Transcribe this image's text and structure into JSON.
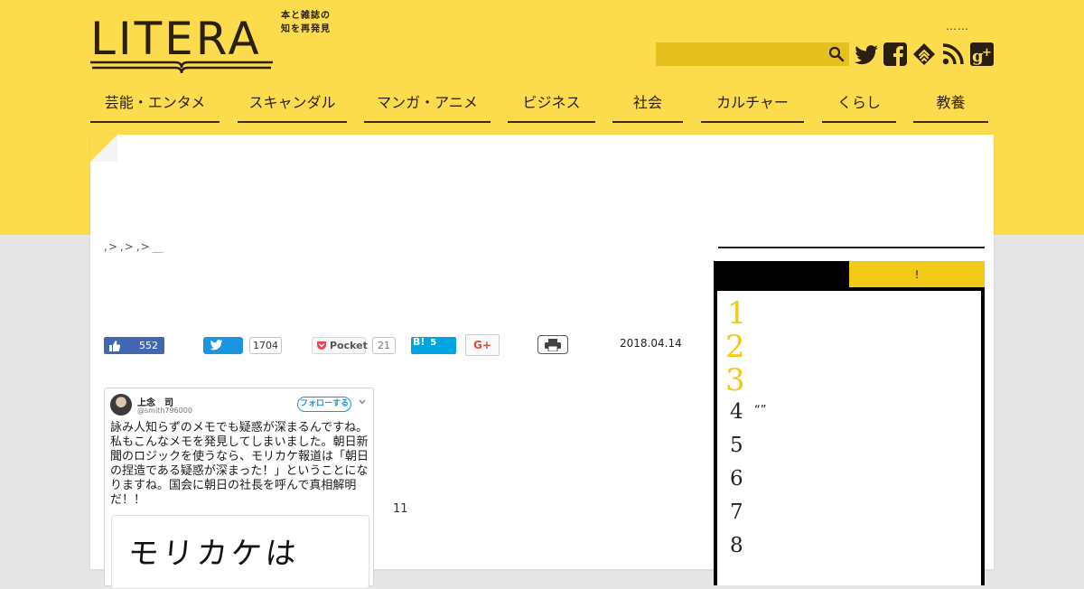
{
  "site": {
    "logo_text": "LITERA",
    "tagline_1": "本と雑誌の",
    "tagline_2": "知を再発見",
    "top_dots": "……"
  },
  "search": {
    "placeholder": ""
  },
  "social_icons": [
    "twitter-icon",
    "facebook-icon",
    "feedly-icon",
    "rss-icon",
    "google-plus-icon"
  ],
  "nav": {
    "items": [
      "芸能・エンタメ",
      "スキャンダル",
      "マンガ・アニメ",
      "ビジネス",
      "社会",
      "カルチャー",
      "くらし",
      "教養"
    ]
  },
  "breadcrumb": {
    "sep1": ">",
    "sep2": ">",
    "sep3": ">",
    "current": "__"
  },
  "share": {
    "fb_count": "552",
    "tw_count": "1704",
    "pocket_label": "Pocket",
    "pocket_count": "21",
    "hatena_label": "B!",
    "hatena_count": "5",
    "gplus_label": "G+"
  },
  "article": {
    "date": "2018.04.14",
    "side_note": "11"
  },
  "tweet": {
    "name": "上念　司",
    "handle": "@smith796000",
    "follow_label": "フォローする",
    "text": "詠み人知らずのメモでも疑惑が深まるんですね。私もこんなメモを発見してしまいました。朝日新聞のロジックを使うなら、モリカケ報道は「朝日の捏造である疑惑が深まった！」ということになりますね。国会に朝日の社長を呼んで真相解明だ！！",
    "image_text": "モリカケは"
  },
  "ranking": {
    "tab_active": "",
    "tab_other": "!",
    "numbers": [
      "1",
      "2",
      "3",
      "4",
      "5",
      "6",
      "7",
      "8"
    ],
    "item4_title": "“”"
  },
  "colors": {
    "brand_yellow": "#fcdc4d",
    "accent_yellow": "#f2c819",
    "text_dark": "#2b1f0f"
  }
}
